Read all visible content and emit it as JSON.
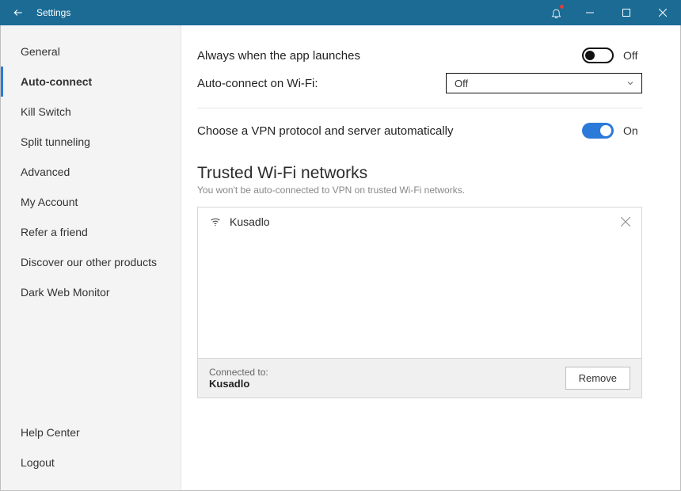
{
  "titlebar": {
    "title": "Settings"
  },
  "sidebar": {
    "items": [
      {
        "label": "General"
      },
      {
        "label": "Auto-connect",
        "active": true
      },
      {
        "label": "Kill Switch"
      },
      {
        "label": "Split tunneling"
      },
      {
        "label": "Advanced"
      },
      {
        "label": "My Account"
      },
      {
        "label": "Refer a friend"
      },
      {
        "label": "Discover our other products"
      },
      {
        "label": "Dark Web Monitor"
      }
    ],
    "bottom": [
      {
        "label": "Help Center"
      },
      {
        "label": "Logout"
      }
    ]
  },
  "main": {
    "launch_label": "Always when the app launches",
    "launch_toggle": "Off",
    "wifi_label": "Auto-connect on Wi-Fi:",
    "wifi_value": "Off",
    "protocol_label": "Choose a VPN protocol and server automatically",
    "protocol_toggle": "On",
    "trusted": {
      "title": "Trusted Wi-Fi networks",
      "subtitle": "You won't be auto-connected to VPN on trusted Wi-Fi networks.",
      "networks": [
        {
          "name": "Kusadlo"
        }
      ],
      "connected_label": "Connected to:",
      "connected_name": "Kusadlo",
      "remove_label": "Remove"
    }
  }
}
